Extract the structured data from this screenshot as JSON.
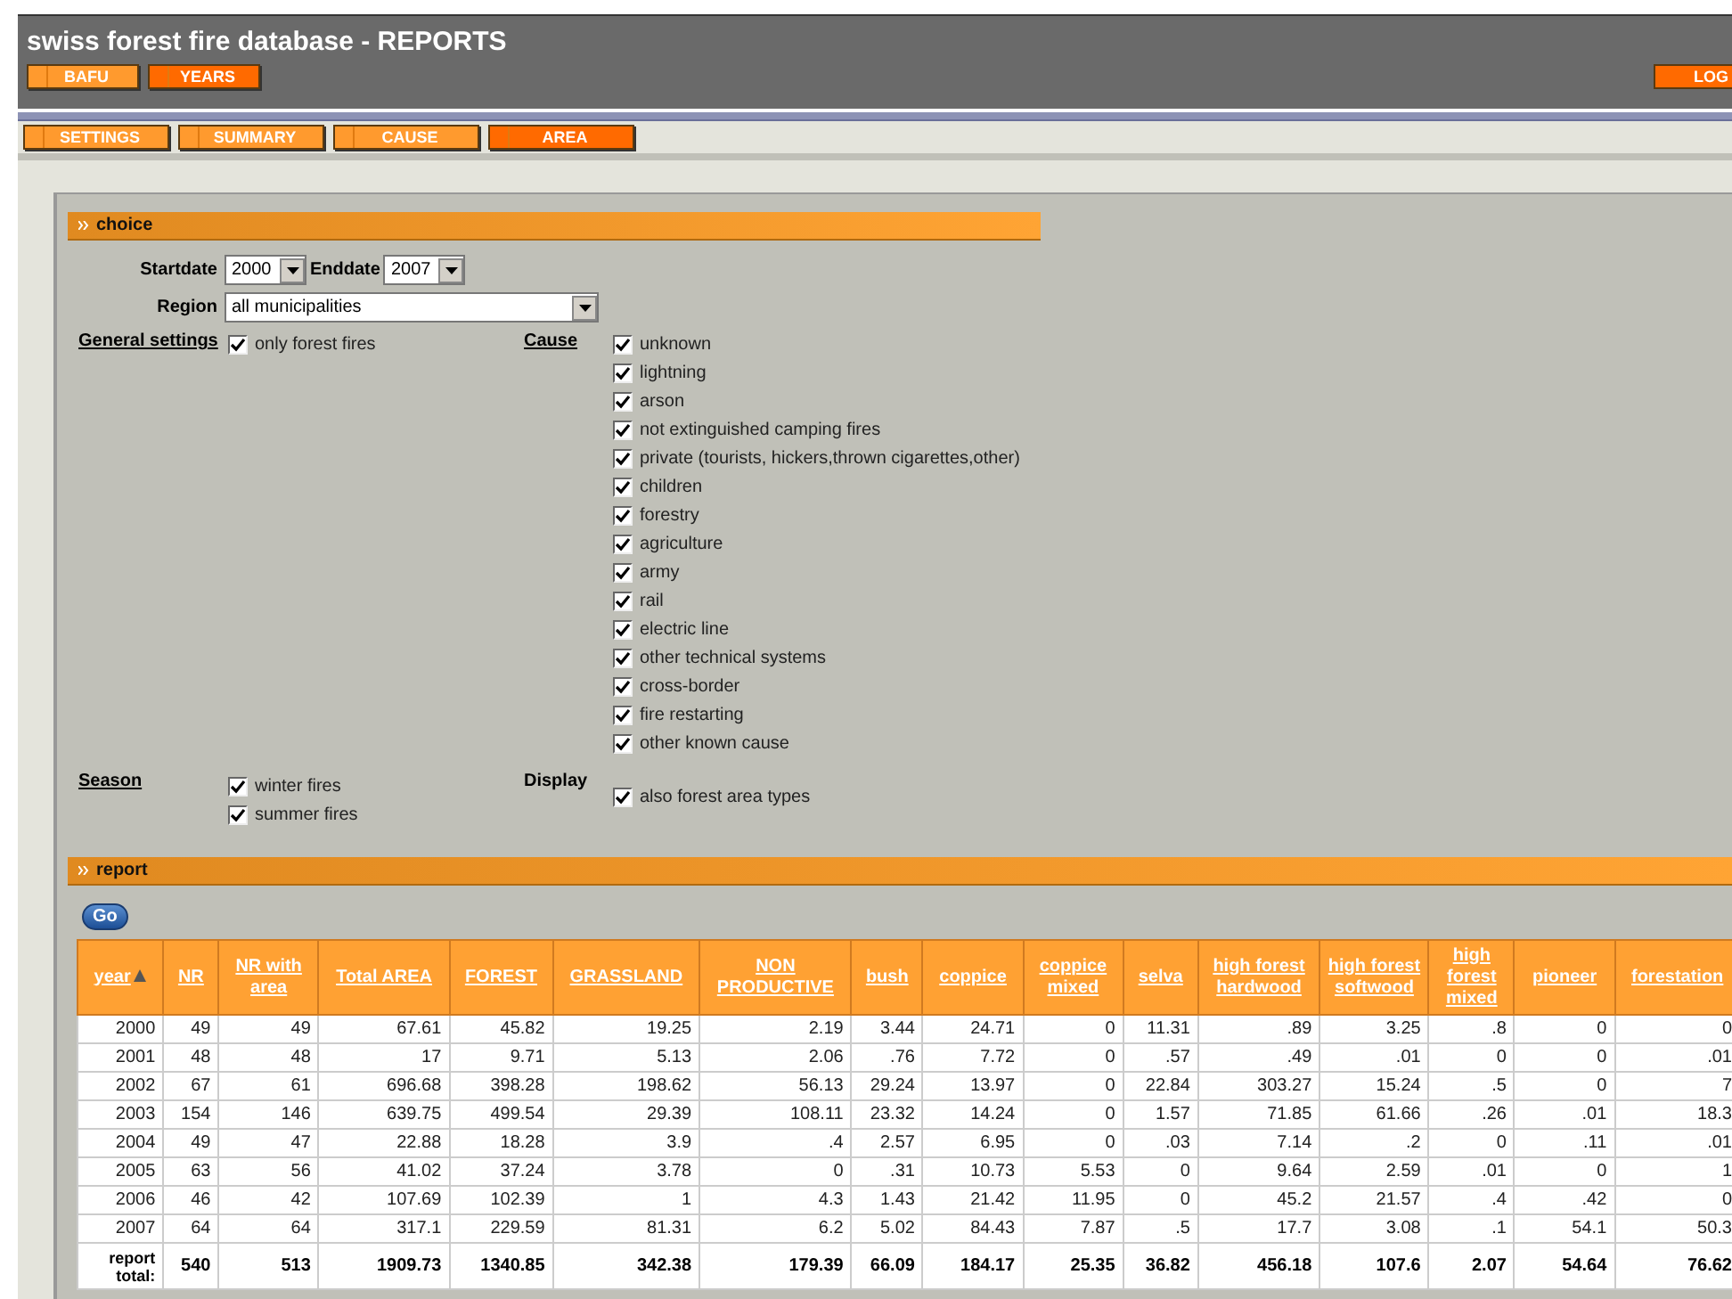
{
  "header": {
    "title": "swiss forest fire database - REPORTS"
  },
  "top_buttons": [
    {
      "label": "BAFU",
      "selected": false
    },
    {
      "label": "YEARS",
      "selected": true
    }
  ],
  "logout_button": {
    "label": "LOG"
  },
  "nav_tabs": [
    {
      "label": "SETTINGS",
      "selected": false
    },
    {
      "label": "SUMMARY",
      "selected": false
    },
    {
      "label": "CAUSE",
      "selected": false
    },
    {
      "label": "AREA",
      "selected": true
    }
  ],
  "choice": {
    "title": "choice",
    "startdate": {
      "label": "Startdate",
      "value": "2000"
    },
    "enddate": {
      "label": "Enddate",
      "value": "2007"
    },
    "region": {
      "label": "Region",
      "value": "all municipalities"
    },
    "general_settings": {
      "label": "General settings",
      "options": [
        {
          "label": "only forest fires",
          "checked": true
        }
      ]
    },
    "cause": {
      "label": "Cause",
      "options": [
        {
          "label": "unknown",
          "checked": true
        },
        {
          "label": "lightning",
          "checked": true
        },
        {
          "label": "arson",
          "checked": true
        },
        {
          "label": "not extinguished camping fires",
          "checked": true
        },
        {
          "label": "private (tourists, hickers,thrown cigarettes,other)",
          "checked": true
        },
        {
          "label": "children",
          "checked": true
        },
        {
          "label": "forestry",
          "checked": true
        },
        {
          "label": "agriculture",
          "checked": true
        },
        {
          "label": "army",
          "checked": true
        },
        {
          "label": "rail",
          "checked": true
        },
        {
          "label": "electric line",
          "checked": true
        },
        {
          "label": "other technical systems",
          "checked": true
        },
        {
          "label": "cross-border",
          "checked": true
        },
        {
          "label": "fire restarting",
          "checked": true
        },
        {
          "label": "other known cause",
          "checked": true
        }
      ]
    },
    "season": {
      "label": "Season",
      "options": [
        {
          "label": "winter fires",
          "checked": true
        },
        {
          "label": "summer fires",
          "checked": true
        }
      ]
    },
    "display": {
      "label": "Display",
      "options": [
        {
          "label": "also forest area types",
          "checked": true
        }
      ]
    }
  },
  "report": {
    "title": "report",
    "go_button": {
      "label": "Go"
    },
    "table": {
      "columns": [
        {
          "label": "year",
          "sorted": true
        },
        {
          "label": "NR",
          "sorted": false
        },
        {
          "label": "NR with area",
          "sorted": false
        },
        {
          "label": "Total AREA",
          "sorted": false
        },
        {
          "label": "FOREST",
          "sorted": false
        },
        {
          "label": "GRASSLAND",
          "sorted": false
        },
        {
          "label": "NON PRODUCTIVE",
          "sorted": false
        },
        {
          "label": "bush",
          "sorted": false
        },
        {
          "label": "coppice",
          "sorted": false
        },
        {
          "label": "coppice mixed",
          "sorted": false
        },
        {
          "label": "selva",
          "sorted": false
        },
        {
          "label": "high forest hardwood",
          "sorted": false
        },
        {
          "label": "high forest softwood",
          "sorted": false
        },
        {
          "label": "high forest mixed",
          "sorted": false
        },
        {
          "label": "pioneer",
          "sorted": false
        },
        {
          "label": "forestation",
          "sorted": false
        }
      ],
      "rows": [
        [
          "2000",
          "49",
          "49",
          "67.61",
          "45.82",
          "19.25",
          "2.19",
          "3.44",
          "24.71",
          "0",
          "11.31",
          ".89",
          "3.25",
          ".8",
          "0",
          "0"
        ],
        [
          "2001",
          "48",
          "48",
          "17",
          "9.71",
          "5.13",
          "2.06",
          ".76",
          "7.72",
          "0",
          ".57",
          ".49",
          ".01",
          "0",
          "0",
          ".01"
        ],
        [
          "2002",
          "67",
          "61",
          "696.68",
          "398.28",
          "198.62",
          "56.13",
          "29.24",
          "13.97",
          "0",
          "22.84",
          "303.27",
          "15.24",
          ".5",
          "0",
          "7"
        ],
        [
          "2003",
          "154",
          "146",
          "639.75",
          "499.54",
          "29.39",
          "108.11",
          "23.32",
          "14.24",
          "0",
          "1.57",
          "71.85",
          "61.66",
          ".26",
          ".01",
          "18.3"
        ],
        [
          "2004",
          "49",
          "47",
          "22.88",
          "18.28",
          "3.9",
          ".4",
          "2.57",
          "6.95",
          "0",
          ".03",
          "7.14",
          ".2",
          "0",
          ".11",
          ".01"
        ],
        [
          "2005",
          "63",
          "56",
          "41.02",
          "37.24",
          "3.78",
          "0",
          ".31",
          "10.73",
          "5.53",
          "0",
          "9.64",
          "2.59",
          ".01",
          "0",
          "1"
        ],
        [
          "2006",
          "46",
          "42",
          "107.69",
          "102.39",
          "1",
          "4.3",
          "1.43",
          "21.42",
          "11.95",
          "0",
          "45.2",
          "21.57",
          ".4",
          ".42",
          "0"
        ],
        [
          "2007",
          "64",
          "64",
          "317.1",
          "229.59",
          "81.31",
          "6.2",
          "5.02",
          "84.43",
          "7.87",
          ".5",
          "17.7",
          "3.08",
          ".1",
          "54.1",
          "50.3"
        ]
      ],
      "total_row": {
        "label": "report total:",
        "values": [
          "540",
          "513",
          "1909.73",
          "1340.85",
          "342.38",
          "179.39",
          "66.09",
          "184.17",
          "25.35",
          "36.82",
          "456.18",
          "107.6",
          "2.07",
          "54.64",
          "76.62"
        ]
      }
    }
  }
}
